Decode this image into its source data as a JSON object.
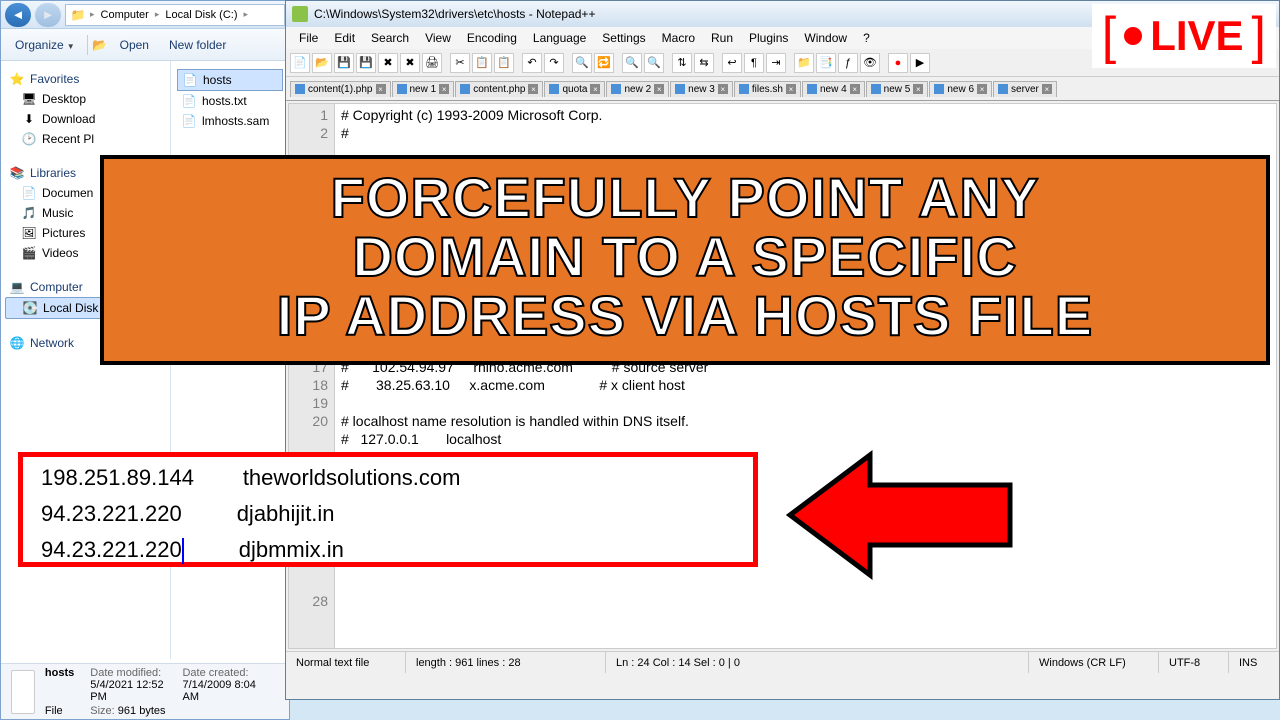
{
  "explorer": {
    "path": {
      "p1": "Computer",
      "p2": "Local Disk (C:)"
    },
    "toolbar": {
      "organize": "Organize",
      "open": "Open",
      "newfolder": "New folder"
    },
    "sidebar": {
      "favorites": "Favorites",
      "fav_items": [
        "Desktop",
        "Download",
        "Recent Pl"
      ],
      "libraries": "Libraries",
      "lib_items": [
        "Documen",
        "Music",
        "Pictures",
        "Videos"
      ],
      "computer": "Computer",
      "comp_items": [
        "Local Disk"
      ],
      "network": "Network"
    },
    "files": [
      "hosts",
      "hosts.txt",
      "lmhosts.sam"
    ],
    "details": {
      "name": "hosts",
      "type": "File",
      "modified_label": "Date modified:",
      "modified": "5/4/2021 12:52 PM",
      "created_label": "Date created:",
      "created": "7/14/2009 8:04 AM",
      "size_label": "Size:",
      "size": "961 bytes"
    }
  },
  "npp": {
    "title": "C:\\Windows\\System32\\drivers\\etc\\hosts - Notepad++",
    "menu": [
      "File",
      "Edit",
      "Search",
      "View",
      "Encoding",
      "Language",
      "Settings",
      "Macro",
      "Run",
      "Plugins",
      "Window",
      "?"
    ],
    "tabs": [
      "content(1).php",
      "new 1",
      "content.php",
      "quota",
      "new 2",
      "new 3",
      "files.sh",
      "new 4",
      "new 5",
      "new 6",
      "server"
    ],
    "code": {
      "l1": "# Copyright (c) 1993-2009 Microsoft Corp.",
      "l2": "#",
      "l16": "#      102.54.94.97     rhino.acme.com          # source server",
      "l17": "#       38.25.63.10     x.acme.com              # x client host",
      "l18": "",
      "l19": "# localhost name resolution is handled within DNS itself.",
      "l20": "#   127.0.0.1       localhost"
    },
    "status": {
      "ftype": "Normal text file",
      "length": "length : 961    lines : 28",
      "pos": "Ln : 24   Col : 14   Sel : 0 | 0",
      "eol": "Windows (CR LF)",
      "enc": "UTF-8",
      "ins": "INS"
    }
  },
  "highlight": {
    "r1": "198.251.89.144        theworldsolutions.com",
    "r2": "94.23.221.220         djabhijit.in",
    "r3_a": "94.23.221.220",
    "r3_b": "         djbmmix.in"
  },
  "overlay": {
    "title_l1": "FORCEFULLY POINT ANY",
    "title_l2": "DOMAIN TO A SPECIFIC",
    "title_l3": "IP ADDRESS VIA HOSTS FILE",
    "live": "LIVE"
  }
}
